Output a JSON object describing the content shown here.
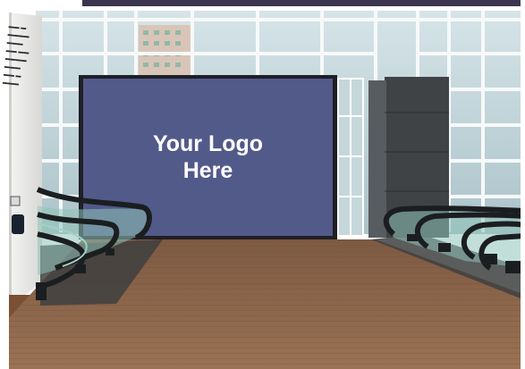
{
  "billboard": {
    "logo_text": "Your Logo\nHere",
    "panel_color": "#525a8a",
    "text_color": "#ffffff"
  },
  "scene": {
    "top_band_color": "#3b3550",
    "floor_color": "#8a6448",
    "wall_color": "#ececea",
    "glass_color": "#bcd4da"
  }
}
